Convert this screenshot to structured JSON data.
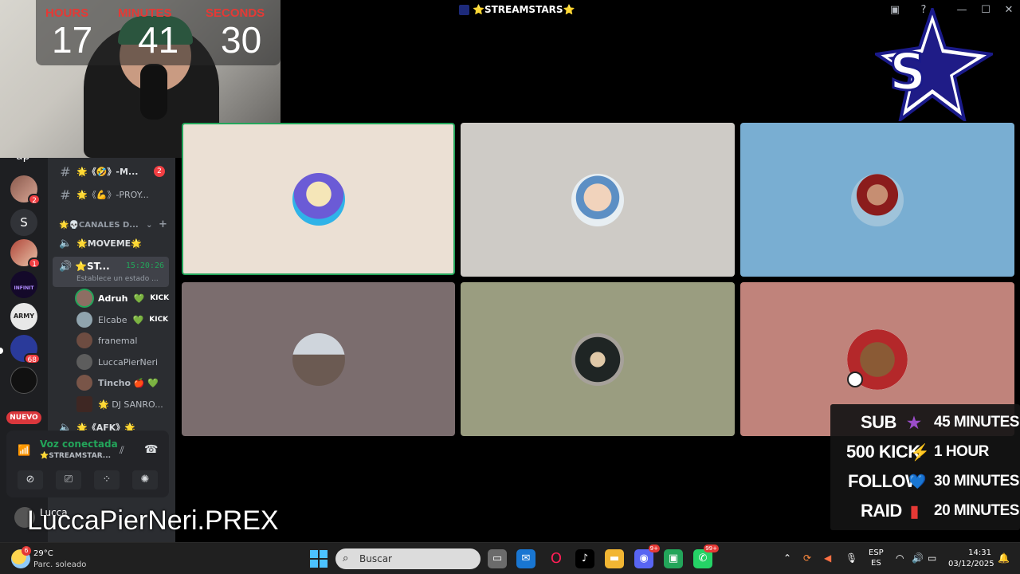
{
  "window": {
    "title": "⭐STREAMSTARS⭐"
  },
  "timer": {
    "hours_label": "HOURS",
    "minutes_label": "MINUTES",
    "seconds_label": "SECONDS",
    "hours": "17",
    "minutes": "41",
    "seconds": "30"
  },
  "server_header": "ap",
  "guilds": [
    {
      "name": "guild-anime",
      "badge": "2"
    },
    {
      "name": "guild-s",
      "letter": "S"
    },
    {
      "name": "guild-streamer",
      "badge": "1"
    },
    {
      "name": "guild-infinit",
      "label": "INFINIT"
    },
    {
      "name": "guild-army",
      "label": "ARMY"
    },
    {
      "name": "guild-streamstars",
      "badge": "68"
    },
    {
      "name": "guild-crew"
    }
  ],
  "nuevo_label": "NUEVO",
  "channels": [
    {
      "icon": "#",
      "name": "🌟《🤣》-M...",
      "badge": "2"
    },
    {
      "icon": "#",
      "name": "🌟《💪》-PROY..."
    }
  ],
  "category": "🌟💀CANALES D...",
  "voice_channels": [
    {
      "name": "🌟MOVEME🌟"
    }
  ],
  "active_voice": {
    "name": "⭐ST...",
    "time": "15:20:26",
    "status": "Establece un estado ..."
  },
  "members": [
    {
      "name": "Adruh",
      "heart": "💚",
      "tag": "KICK",
      "speaking": true
    },
    {
      "name": "Elcabe",
      "heart": "💚",
      "tag": "KICK"
    },
    {
      "name": "franemal"
    },
    {
      "name": "LuccaPierNeri"
    },
    {
      "name": "Tincho 🍎 💚"
    },
    {
      "name": "🌟 DJ SANRO..."
    }
  ],
  "next_channel": "🌟《AFK》🌟",
  "voice_panel": {
    "status": "Voz conectada",
    "server": "⭐STREAMSTAR..."
  },
  "user_panel": {
    "name": "Lucca"
  },
  "tiles": [
    {
      "bg": "#ebe0d4",
      "active": true
    },
    {
      "bg": "#cecbc6"
    },
    {
      "bg": "#79aed2"
    },
    {
      "bg": "#7b6d6e"
    },
    {
      "bg": "#9a9d80"
    },
    {
      "bg": "#c0837b"
    }
  ],
  "rules": [
    {
      "key": "SUB",
      "icon": "★",
      "icon_color": "#9b4dca",
      "value": "45 MINUTES"
    },
    {
      "key": "500 KICK",
      "icon": "⚡",
      "icon_color": "#ffc107",
      "value": "1 HOUR"
    },
    {
      "key": "FOLLOW",
      "icon": "💙",
      "icon_color": "#1e88e5",
      "value": "30 MINUTES"
    },
    {
      "key": "RAID",
      "icon": "▮",
      "icon_color": "#e53935",
      "value": "20 MINUTES"
    }
  ],
  "watermark": "LuccaPierNeri.PREX",
  "taskbar": {
    "weather_temp": "29°C",
    "weather_desc": "Parc. soleado",
    "weather_badge": "6",
    "search_placeholder": "Buscar",
    "discord_badge": "9+",
    "whatsapp_badge": "99+",
    "lang_line1": "ESP",
    "lang_line2": "ES",
    "time": "14:31",
    "date": "03/12/2025"
  }
}
